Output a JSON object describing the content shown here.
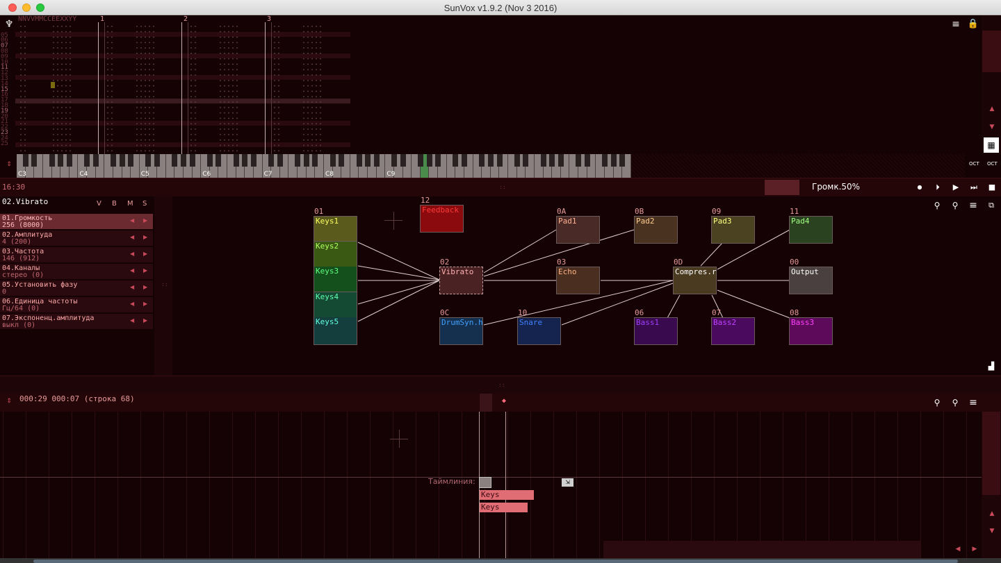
{
  "window": {
    "title": "SunVox v1.9.2 (Nov  3 2016)"
  },
  "pattern_editor": {
    "header_text": "NNVVMMCCEEXXYY",
    "column_numbers": [
      "1",
      "2",
      "3"
    ],
    "row_numbers": [
      "",
      "",
      "05",
      "06",
      "07",
      "08",
      "09",
      "10",
      "11",
      "12",
      "13",
      "14",
      "15",
      "16",
      "17",
      "18",
      "19",
      "20",
      "21",
      "22",
      "23",
      "24",
      "25"
    ]
  },
  "keyboard": {
    "octaves": [
      "C3",
      "C4",
      "C5",
      "C6",
      "C7",
      "C8",
      "C9"
    ]
  },
  "status": {
    "time": "16:30",
    "volume_label": "Громк.50%"
  },
  "controllers": {
    "module_title": "02.Vibrato",
    "headers": [
      "V",
      "B",
      "M",
      "S"
    ],
    "items": [
      {
        "name": "01.Громкость",
        "value": "256 (8000)",
        "active": true
      },
      {
        "name": "02.Амплитуда",
        "value": "4 (200)",
        "active": false
      },
      {
        "name": "03.Частота",
        "value": "146 (912)",
        "active": false
      },
      {
        "name": "04.Каналы",
        "value": "стерео (0)",
        "active": false
      },
      {
        "name": "05.Установить фазу",
        "value": "0",
        "active": false
      },
      {
        "name": "06.Единица частоты",
        "value": "Гц/64 (0)",
        "active": false
      },
      {
        "name": "07.Экспоненц.амплитуда",
        "value": "выкл (0)",
        "active": false
      }
    ]
  },
  "modules": [
    {
      "id": "keys1",
      "num": "01",
      "name": "Keys1",
      "bg": "#5a5a1c",
      "fg": "#ffff60"
    },
    {
      "id": "keys2",
      "num": "",
      "name": "Keys2",
      "bg": "#3a5a14",
      "fg": "#b0ff60"
    },
    {
      "id": "keys3",
      "num": "",
      "name": "Keys3",
      "bg": "#14501c",
      "fg": "#60ff80"
    },
    {
      "id": "keys4",
      "num": "",
      "name": "Keys4",
      "bg": "#144a34",
      "fg": "#60ffb0"
    },
    {
      "id": "keys5",
      "num": "",
      "name": "Keys5",
      "bg": "#143e3e",
      "fg": "#60ffe0"
    },
    {
      "id": "feedback",
      "num": "12",
      "name": "Feedback",
      "bg": "#8a0a0e",
      "fg": "#ff3a3a"
    },
    {
      "id": "vibrato",
      "num": "02",
      "name": "Vibrato",
      "bg": "#4a2224",
      "fg": "#ffb0b0"
    },
    {
      "id": "pad1",
      "num": "0A",
      "name": "Pad1",
      "bg": "#4a2a26",
      "fg": "#ffb090"
    },
    {
      "id": "pad2",
      "num": "0B",
      "name": "Pad2",
      "bg": "#4a3220",
      "fg": "#ffcc90"
    },
    {
      "id": "pad3",
      "num": "09",
      "name": "Pad3",
      "bg": "#4a4220",
      "fg": "#ffff80"
    },
    {
      "id": "pad4",
      "num": "11",
      "name": "Pad4",
      "bg": "#2a4220",
      "fg": "#a0ff80"
    },
    {
      "id": "echo",
      "num": "03",
      "name": "Echo",
      "bg": "#4a2e20",
      "fg": "#ffb080"
    },
    {
      "id": "compressor",
      "num": "0D",
      "name": "Compres.r",
      "bg": "#4a3a20",
      "fg": "#ffffff"
    },
    {
      "id": "output",
      "num": "00",
      "name": "Output",
      "bg": "#4a4040",
      "fg": "#ffffff"
    },
    {
      "id": "drumsynth",
      "num": "0C",
      "name": "DrumSyn.h",
      "bg": "#14304e",
      "fg": "#40a0ff"
    },
    {
      "id": "snare",
      "num": "10",
      "name": "Snare",
      "bg": "#14244e",
      "fg": "#4080ff"
    },
    {
      "id": "bass1",
      "num": "06",
      "name": "Bass1",
      "bg": "#3a0a4e",
      "fg": "#a040ff"
    },
    {
      "id": "bass2",
      "num": "07",
      "name": "Bass2",
      "bg": "#4a0a5e",
      "fg": "#c040ff"
    },
    {
      "id": "bass3",
      "num": "08",
      "name": "Bass3",
      "bg": "#5e0a5a",
      "fg": "#ff40ff"
    }
  ],
  "timeline": {
    "time_text": "000:29 000:07 (строка 68)",
    "label": "Таймлиния",
    "patterns": [
      {
        "name": "Keys"
      },
      {
        "name": "Keys"
      }
    ]
  }
}
